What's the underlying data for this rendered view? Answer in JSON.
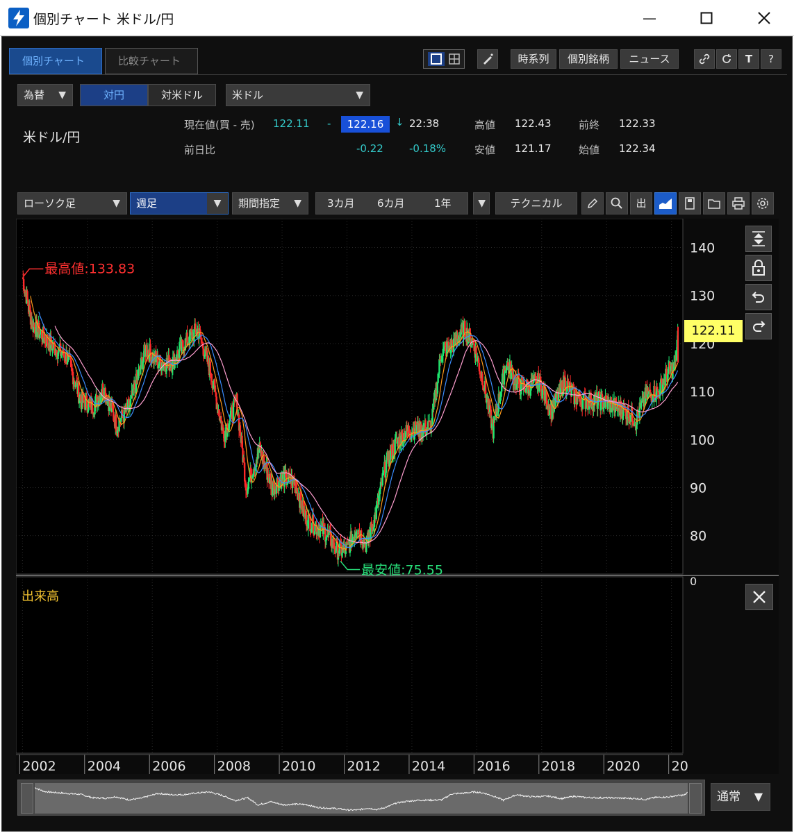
{
  "window": {
    "title": "個別チャート 米ドル/円"
  },
  "tabs": [
    {
      "label": "個別チャート",
      "active": true
    },
    {
      "label": "比較チャート",
      "active": false
    }
  ],
  "top_toolbar": {
    "buttons": [
      "時系列",
      "個別銘柄",
      "ニュース"
    ],
    "icons": [
      "single-layout-icon",
      "grid-layout-icon",
      "pen-icon",
      "link-icon",
      "refresh-icon",
      "text-icon",
      "help-icon"
    ],
    "text_icon_label": "T",
    "help_label": "?"
  },
  "controls": {
    "category": "為替",
    "segment_on": "対円",
    "segment_off": "対米ドル",
    "currency": "米ドル"
  },
  "quote": {
    "pair": "米ドル/円",
    "current_label": "現在値(買 - 売)",
    "bid": "122.11",
    "sep": "-",
    "ask": "122.16",
    "direction": "↓",
    "time": "22:38",
    "high_label": "高値",
    "high": "122.43",
    "prev_close_label": "前終",
    "prev_close": "122.33",
    "change_label": "前日比",
    "change": "-0.22",
    "change_pct": "-0.18%",
    "low_label": "安値",
    "low": "121.17",
    "open_label": "始値",
    "open": "122.34"
  },
  "chart_toolbar": {
    "chart_type": "ローソク足",
    "period": "週足",
    "range_mode": "期間指定",
    "ranges": [
      "3カ月",
      "6カ月",
      "1年"
    ],
    "technical": "テクニカル",
    "out_label": "出"
  },
  "chart_data": {
    "type": "candlestick",
    "timeframe": "weekly",
    "y_ticks": [
      140,
      130,
      120,
      110,
      100,
      90,
      80
    ],
    "x_labels": [
      "2002",
      "2004",
      "2006",
      "2008",
      "2010",
      "2012",
      "2014",
      "2016",
      "2018",
      "2020",
      "20"
    ],
    "ylim": [
      72,
      146
    ],
    "current_price_label": "122.11",
    "max_label": "最高値:133.83",
    "min_label": "最安値:75.55",
    "volume_panel_title": "出来高",
    "volume_axis_label": "0",
    "approx_close_series": [
      [
        2002.0,
        133.8
      ],
      [
        2002.3,
        124
      ],
      [
        2002.7,
        121
      ],
      [
        2003.0,
        119
      ],
      [
        2003.4,
        117
      ],
      [
        2003.8,
        108
      ],
      [
        2004.2,
        107
      ],
      [
        2004.5,
        111
      ],
      [
        2004.9,
        103
      ],
      [
        2005.3,
        107
      ],
      [
        2005.8,
        119
      ],
      [
        2006.2,
        116
      ],
      [
        2006.6,
        116
      ],
      [
        2007.0,
        120
      ],
      [
        2007.4,
        123
      ],
      [
        2007.8,
        114
      ],
      [
        2008.2,
        101
      ],
      [
        2008.6,
        108
      ],
      [
        2008.9,
        90
      ],
      [
        2009.3,
        98
      ],
      [
        2009.7,
        90
      ],
      [
        2010.0,
        92
      ],
      [
        2010.4,
        91
      ],
      [
        2010.7,
        84
      ],
      [
        2011.0,
        82
      ],
      [
        2011.3,
        81
      ],
      [
        2011.7,
        77
      ],
      [
        2012.0,
        77
      ],
      [
        2012.3,
        82
      ],
      [
        2012.6,
        78
      ],
      [
        2012.9,
        85
      ],
      [
        2013.2,
        95
      ],
      [
        2013.5,
        99
      ],
      [
        2013.9,
        102
      ],
      [
        2014.3,
        102
      ],
      [
        2014.6,
        103
      ],
      [
        2014.9,
        118
      ],
      [
        2015.3,
        120
      ],
      [
        2015.6,
        123
      ],
      [
        2015.9,
        120
      ],
      [
        2016.2,
        112
      ],
      [
        2016.5,
        102
      ],
      [
        2016.9,
        116
      ],
      [
        2017.3,
        111
      ],
      [
        2017.6,
        111
      ],
      [
        2017.9,
        112
      ],
      [
        2018.3,
        106
      ],
      [
        2018.7,
        112
      ],
      [
        2019.0,
        109
      ],
      [
        2019.4,
        108
      ],
      [
        2019.8,
        108
      ],
      [
        2020.2,
        107
      ],
      [
        2020.6,
        106
      ],
      [
        2020.9,
        104
      ],
      [
        2021.2,
        109
      ],
      [
        2021.6,
        110
      ],
      [
        2021.9,
        114
      ],
      [
        2022.1,
        115
      ],
      [
        2022.2,
        122.1
      ]
    ]
  },
  "sidebar": {
    "icons": [
      "fit-vertical-icon",
      "lock-icon",
      "undo-icon",
      "redo-icon"
    ]
  },
  "navigator": {
    "mode": "通常"
  }
}
